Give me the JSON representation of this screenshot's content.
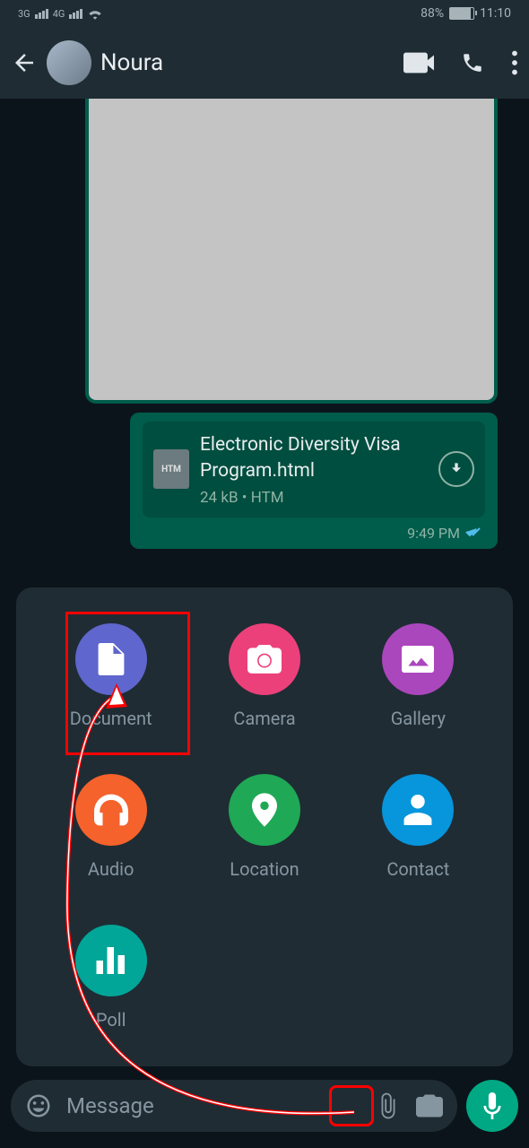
{
  "status": {
    "network1": "3G",
    "network2": "4G",
    "battery_pct": "88%",
    "time": "11:10"
  },
  "header": {
    "contact_name": "Noura"
  },
  "message": {
    "doc_name": "Electronic Diversity Visa Program.html",
    "doc_size": "24 kB",
    "doc_type": "HTM",
    "doc_icon_label": "HTM",
    "time": "9:49 PM"
  },
  "attachments": {
    "document": "Document",
    "camera": "Camera",
    "gallery": "Gallery",
    "audio": "Audio",
    "location": "Location",
    "contact": "Contact",
    "poll": "Poll"
  },
  "input": {
    "placeholder": "Message"
  }
}
